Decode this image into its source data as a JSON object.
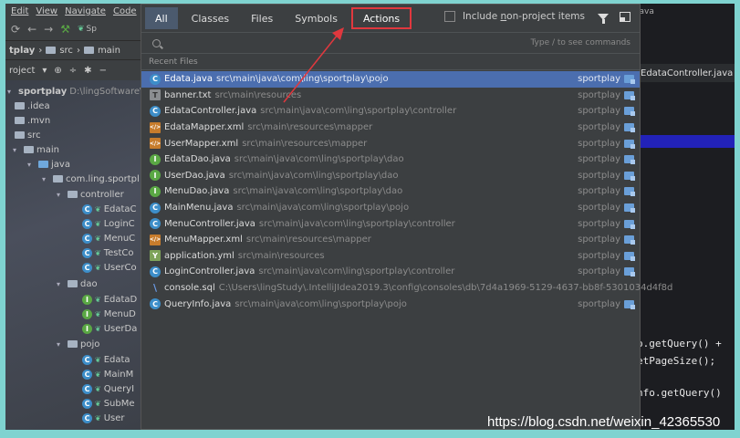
{
  "ide": {
    "menu": [
      "Edit",
      "View",
      "Navigate",
      "Code"
    ],
    "run_config_label": "Sp",
    "breadcrumb": [
      "tplay",
      "src",
      "main"
    ],
    "project_label": "roject",
    "tree": [
      {
        "label": "sportplay",
        "extra": "D:\\lingSoftware\\Jav"
      },
      {
        "label": ".idea"
      },
      {
        "label": ".mvn"
      },
      {
        "label": "src"
      },
      {
        "label": "main"
      },
      {
        "label": "java"
      },
      {
        "label": "com.ling.sportpl"
      },
      {
        "label": "controller"
      },
      {
        "label": "EdataC"
      },
      {
        "label": "LoginC"
      },
      {
        "label": "MenuC"
      },
      {
        "label": "TestCo"
      },
      {
        "label": "UserCo"
      },
      {
        "label": "dao"
      },
      {
        "label": "EdataD"
      },
      {
        "label": "MenuD"
      },
      {
        "label": "UserDa"
      },
      {
        "label": "pojo"
      },
      {
        "label": "Edata"
      },
      {
        "label": "MainM"
      },
      {
        "label": "QueryI"
      },
      {
        "label": "SubMe"
      },
      {
        "label": "User"
      }
    ]
  },
  "editor": {
    "title_fragment": "java",
    "tab_label": "EdataController.java",
    "code_lines": [
      "o.getQuery() +",
      "etPageSize();",
      "nfo.getQuery()"
    ]
  },
  "popup": {
    "tabs": [
      "All",
      "Classes",
      "Files",
      "Symbols",
      "Actions"
    ],
    "active_tab": "All",
    "highlighted_tab": "Actions",
    "include_label_pre": "Include ",
    "include_label_u": "n",
    "include_label_post": "on-project items",
    "search_value": "",
    "search_hint": "Type / to see commands",
    "section_title": "Recent Files",
    "results": [
      {
        "icon": "class",
        "name": "Edata.java",
        "path": "src\\main\\java\\com\\ling\\sportplay\\pojo",
        "module": "sportplay",
        "selected": true
      },
      {
        "icon": "txt",
        "name": "banner.txt",
        "path": "src\\main\\resources",
        "module": "sportplay"
      },
      {
        "icon": "class",
        "name": "EdataController.java",
        "path": "src\\main\\java\\com\\ling\\sportplay\\controller",
        "module": "sportplay"
      },
      {
        "icon": "xml",
        "name": "EdataMapper.xml",
        "path": "src\\main\\resources\\mapper",
        "module": "sportplay"
      },
      {
        "icon": "xml",
        "name": "UserMapper.xml",
        "path": "src\\main\\resources\\mapper",
        "module": "sportplay"
      },
      {
        "icon": "iface",
        "name": "EdataDao.java",
        "path": "src\\main\\java\\com\\ling\\sportplay\\dao",
        "module": "sportplay"
      },
      {
        "icon": "iface",
        "name": "UserDao.java",
        "path": "src\\main\\java\\com\\ling\\sportplay\\dao",
        "module": "sportplay"
      },
      {
        "icon": "iface",
        "name": "MenuDao.java",
        "path": "src\\main\\java\\com\\ling\\sportplay\\dao",
        "module": "sportplay"
      },
      {
        "icon": "class",
        "name": "MainMenu.java",
        "path": "src\\main\\java\\com\\ling\\sportplay\\pojo",
        "module": "sportplay"
      },
      {
        "icon": "class",
        "name": "MenuController.java",
        "path": "src\\main\\java\\com\\ling\\sportplay\\controller",
        "module": "sportplay"
      },
      {
        "icon": "xml",
        "name": "MenuMapper.xml",
        "path": "src\\main\\resources\\mapper",
        "module": "sportplay"
      },
      {
        "icon": "yml",
        "name": "application.yml",
        "path": "src\\main\\resources",
        "module": "sportplay"
      },
      {
        "icon": "class",
        "name": "LoginController.java",
        "path": "src\\main\\java\\com\\ling\\sportplay\\controller",
        "module": "sportplay"
      },
      {
        "icon": "sql",
        "name": "console.sql",
        "path": "C:\\Users\\lingStudy\\.IntelliJIdea2019.3\\config\\consoles\\db\\7d4a1969-5129-4637-bb8f-5301034d4f8d",
        "module": ""
      },
      {
        "icon": "class",
        "name": "QueryInfo.java",
        "path": "src\\main\\java\\com\\ling\\sportplay\\pojo",
        "module": "sportplay"
      }
    ]
  },
  "watermark": "https://blog.csdn.net/weixin_42365530",
  "colors": {
    "selection": "#4b6eaf",
    "annotation": "#e0383e"
  }
}
